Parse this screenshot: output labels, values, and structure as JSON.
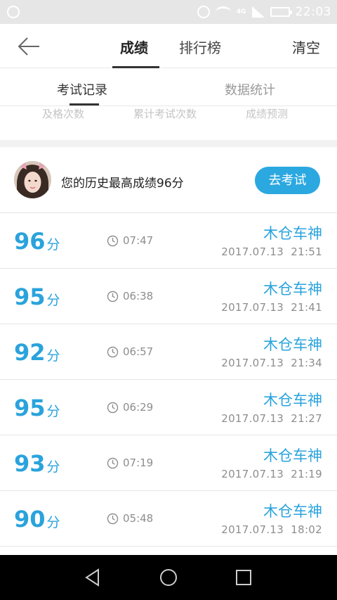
{
  "status_bar": {
    "network": "4G",
    "time": "22:03"
  },
  "top_nav": {
    "tabs": [
      "成绩",
      "排行榜"
    ],
    "active_tab": "成绩",
    "clear_label": "清空"
  },
  "sub_tabs": {
    "items": [
      "考试记录",
      "数据统计"
    ],
    "active": "考试记录"
  },
  "stats_peek": {
    "labels": [
      "及格次数",
      "累计考试次数",
      "成绩预测"
    ]
  },
  "best": {
    "text": "您的历史最高成绩96分",
    "go_exam_label": "去考试"
  },
  "score_unit": "分",
  "records": [
    {
      "score": "96",
      "duration": "07:47",
      "mode": "木仓车神",
      "date": "2017.07.13",
      "time": "21:51"
    },
    {
      "score": "95",
      "duration": "06:38",
      "mode": "木仓车神",
      "date": "2017.07.13",
      "time": "21:41"
    },
    {
      "score": "92",
      "duration": "06:57",
      "mode": "木仓车神",
      "date": "2017.07.13",
      "time": "21:34"
    },
    {
      "score": "95",
      "duration": "06:29",
      "mode": "木仓车神",
      "date": "2017.07.13",
      "time": "21:27"
    },
    {
      "score": "93",
      "duration": "07:19",
      "mode": "木仓车神",
      "date": "2017.07.13",
      "time": "21:19"
    },
    {
      "score": "90",
      "duration": "05:48",
      "mode": "木仓车神",
      "date": "2017.07.13",
      "time": "18:02"
    }
  ],
  "colors": {
    "accent": "#2aa3dc",
    "button": "#2ba8e0",
    "muted_text": "#8d8d8d"
  },
  "icons": {
    "back": "arrow-left-icon",
    "duration": "clock-icon",
    "nav_back": "triangle-back-icon",
    "nav_home": "circle-home-icon",
    "nav_recent": "square-recent-icon"
  }
}
